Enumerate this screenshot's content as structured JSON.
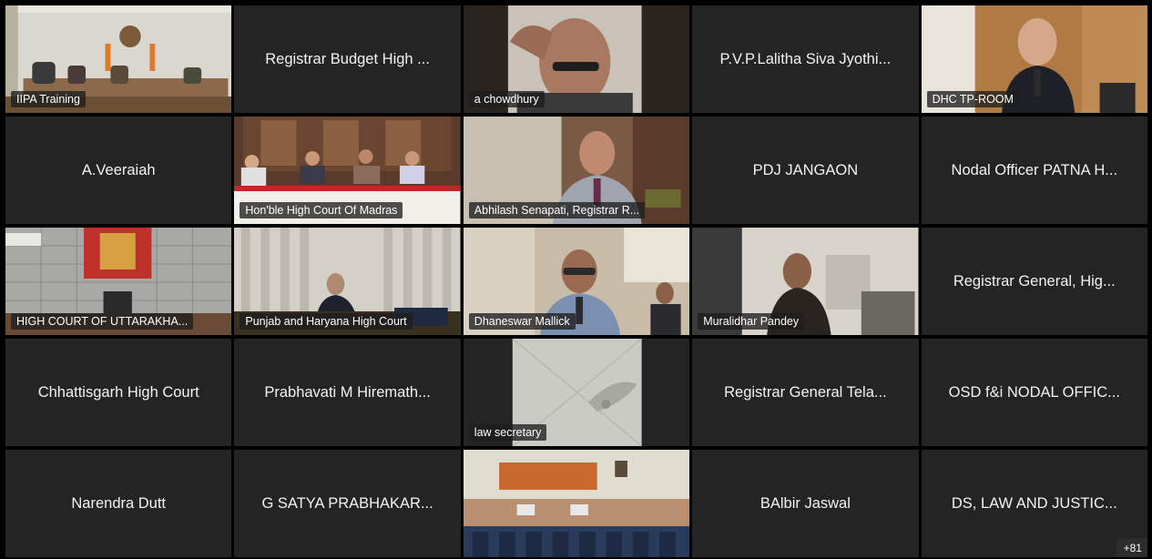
{
  "gallery": {
    "tiles": [
      {
        "label": "IIPA Training"
      },
      {
        "label": "Registrar Budget High ..."
      },
      {
        "label": "a chowdhury"
      },
      {
        "label": "P.V.P.Lalitha Siva Jyothi..."
      },
      {
        "label": "DHC TP-ROOM"
      },
      {
        "label": "A.Veeraiah"
      },
      {
        "label": "Hon'ble High Court Of Madras"
      },
      {
        "label": "Abhilash Senapati, Registrar R..."
      },
      {
        "label": "PDJ JANGAON"
      },
      {
        "label": "Nodal Officer PATNA H..."
      },
      {
        "label": "HIGH COURT OF UTTARAKHA..."
      },
      {
        "label": "Punjab and Haryana High Court"
      },
      {
        "label": "Dhaneswar Mallick"
      },
      {
        "label": "Muralidhar Pandey"
      },
      {
        "label": "Registrar General, Hig..."
      },
      {
        "label": "Chhattisgarh High Court"
      },
      {
        "label": "Prabhavati M Hiremath..."
      },
      {
        "label": "law secretary"
      },
      {
        "label": "Registrar General Tela..."
      },
      {
        "label": "OSD f&i NODAL OFFIC..."
      },
      {
        "label": "Narendra Dutt"
      },
      {
        "label": "G SATYA PRABHAKAR..."
      },
      {
        "label": ""
      },
      {
        "label": "BAlbir Jaswal"
      },
      {
        "label": "DS, LAW AND JUSTIC..."
      }
    ],
    "overflow_count": "+81"
  }
}
